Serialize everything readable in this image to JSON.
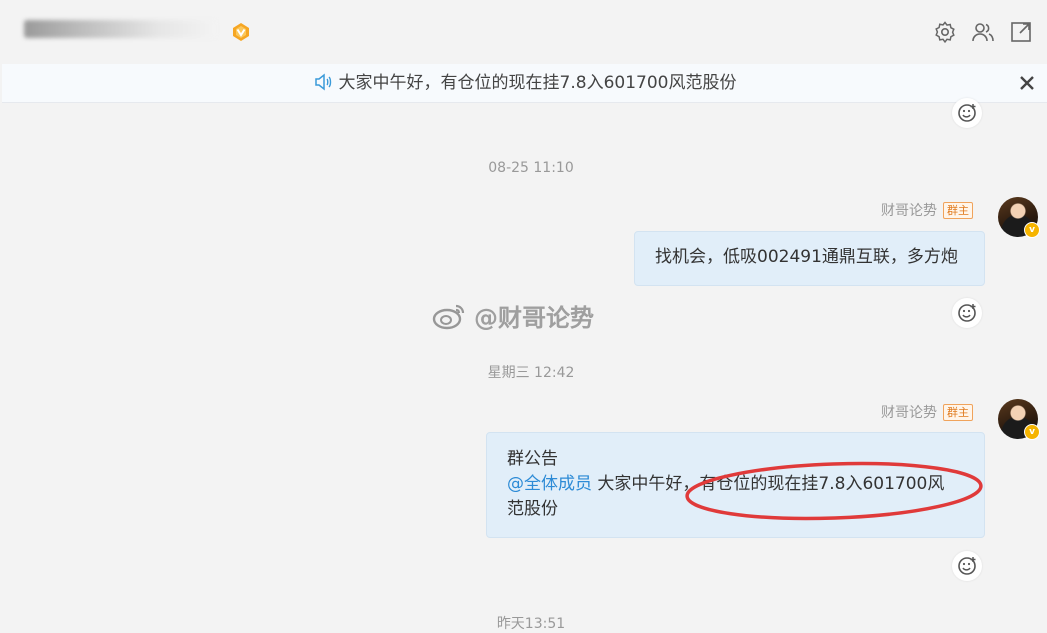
{
  "header": {
    "vip_icon": "vip-diamond-icon",
    "icons": [
      "gear-icon",
      "members-icon",
      "popout-icon"
    ]
  },
  "notice": {
    "icon": "speaker-icon",
    "text": "大家中午好，有仓位的现在挂7.8入601700风范股份",
    "close_icon": "close-icon"
  },
  "messages": [
    {
      "timestamp": "08-25 11:10"
    },
    {
      "sender": "财哥论势",
      "role_badge": "群主",
      "text": "找机会，低吸002491通鼎互联，多方炮"
    },
    {
      "timestamp": "星期三 12:42"
    },
    {
      "sender": "财哥论势",
      "role_badge": "群主",
      "title": "群公告",
      "mention": "@全体成员",
      "body_line1": " 大家中午好，有仓位的现在挂7.8入601700风",
      "body_line2": "范股份"
    },
    {
      "timestamp": "昨天13:51"
    }
  ],
  "watermark": "@财哥论势",
  "colors": {
    "bubble": "#e1eef9",
    "mention": "#2d8bd6",
    "badge": "#e07b1f",
    "annotation": "#e03a3a"
  }
}
